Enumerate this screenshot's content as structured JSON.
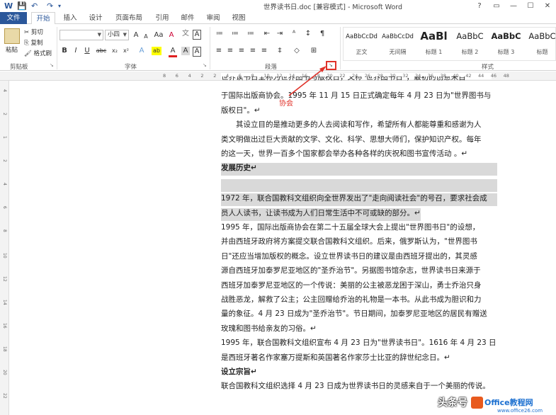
{
  "window": {
    "title": "世界读书日.doc [兼容模式] - Microsoft Word",
    "controls": [
      "?",
      "▭",
      "—",
      "☐",
      "✕"
    ]
  },
  "quick_access": [
    "W",
    "💾",
    "↶",
    "↷",
    "▾"
  ],
  "tabs": [
    "文件",
    "开始",
    "插入",
    "设计",
    "页面布局",
    "引用",
    "邮件",
    "审阅",
    "视图"
  ],
  "ribbon": {
    "clipboard": {
      "paste": "粘贴",
      "cut": "剪切",
      "copy": "复制",
      "format_painter": "格式刷",
      "group_label": "剪贴板"
    },
    "font": {
      "font_name": "",
      "font_size": "小四",
      "group_label": "字体",
      "row1_icons": [
        "A",
        "A",
        "Aa",
        "A"
      ],
      "row2_icons": [
        "B",
        "I",
        "U",
        "abc",
        "x₂",
        "x²",
        "A",
        "ab",
        "A",
        "A",
        "A"
      ]
    },
    "paragraph": {
      "group_label": "段落",
      "row1_icons": [
        "≔",
        "≔",
        "≔",
        "⇤",
        "⇥",
        "ᴬ",
        "↕",
        "¶"
      ],
      "row2_icons": [
        "≡",
        "≡",
        "≡",
        "≡",
        "≡",
        "‡",
        "◇",
        "⊞"
      ]
    },
    "styles": {
      "group_label": "样式",
      "items": [
        {
          "preview": "AaBbCcDd",
          "name": "正文"
        },
        {
          "preview": "AaBbCcDd",
          "name": "无间隔"
        },
        {
          "preview": "AaBl",
          "name": "标题 1"
        },
        {
          "preview": "AaBbC",
          "name": "标题 2"
        },
        {
          "preview": "AaBbC",
          "name": "标题 3"
        },
        {
          "preview": "AaBbC",
          "name": "标题"
        }
      ]
    }
  },
  "ruler": {
    "ticks": [
      "8",
      "6",
      "4",
      "2",
      "2",
      "4",
      "6",
      "8",
      "10",
      "12",
      "14",
      "16",
      "18",
      "20",
      "22",
      "24",
      "26",
      "28",
      "30",
      "32",
      "34",
      "36",
      "38",
      "40",
      "42",
      "44",
      "46",
      "48"
    ],
    "vticks": [
      "4",
      "2",
      "1",
      "2",
      "4",
      "6",
      "8",
      "10",
      "12",
      "14",
      "16",
      "18",
      "20",
      "22"
    ]
  },
  "annotation": {
    "tip": "协会"
  },
  "document": {
    "lines": [
      {
        "text": "世界读书日全称为世界图书与版权日，又称\"世界图书日\"，最初的创意来自",
        "style": "cut"
      },
      {
        "text": "于国际出版商协会。1995 年 11 月 15 日正式确定每年 4 月 23 日为\"世界图书与",
        "style": "normal"
      },
      {
        "text": "版权日\"。↵",
        "style": "normal"
      },
      {
        "text": "　　其设立目的是推动更多的人去阅读和写作，希望所有人都能尊重和感谢为人",
        "style": "normal"
      },
      {
        "text": "类文明做出过巨大贡献的文学、文化、科学、思想大师们，保护知识产权。每年",
        "style": "normal"
      },
      {
        "text": "的这一天，世界一百多个国家都会举办各种各样的庆祝和图书宣传活动 。↵",
        "style": "normal"
      },
      {
        "text": "发展历史↵",
        "style": "heading-hl"
      },
      {
        "text": "",
        "style": "hl"
      },
      {
        "text": "1972 年，联合国教科文组织向全世界发出了\"走向阅读社会\"的号召，要求社会成",
        "style": "hl"
      },
      {
        "text": "员人人读书，让读书成为人们日常生活中不可或缺的部分。↵",
        "style": "hl-short"
      },
      {
        "text": "1995  年，国际出版商协会在第二十五届全球大会上提出\"世界图书日\"的设想，",
        "style": "normal"
      },
      {
        "text": "并由西班牙政府将方案提交联合国教科文组织。后来，俄罗斯认为，\"世界图书",
        "style": "normal"
      },
      {
        "text": "日\"还应当增加版权的概念。设立世界读书日的建议是由西班牙提出的，其灵感",
        "style": "normal"
      },
      {
        "text": "源自西班牙加泰罗尼亚地区的\"圣乔治节\"。另据图书馆杂志，世界读书日来源于",
        "style": "normal"
      },
      {
        "text": "西班牙加泰罗尼亚地区的一个传说：美丽的公主被恶龙困于深山，勇士乔治只身",
        "style": "normal"
      },
      {
        "text": "战胜恶龙，解救了公主；公主回赠给乔治的礼物是一本书。从此书成为胆识和力",
        "style": "normal"
      },
      {
        "text": "量的象征。4 月 23 日成为\"圣乔治节\"。节日期间，加泰罗尼亚地区的居民有赠送",
        "style": "normal"
      },
      {
        "text": "玫瑰和图书给亲友的习俗。↵",
        "style": "normal"
      },
      {
        "text": "1995 年，联合国教科文组织宣布 4 月 23 日为\"世界读书日\"。1616 年 4 月 23 日",
        "style": "normal"
      },
      {
        "text": "是西班牙著名作家塞万提斯和英国著名作家莎士比亚的辞世纪念日。↵",
        "style": "normal"
      },
      {
        "text": "设立宗旨↵",
        "style": "heading"
      },
      {
        "text": "联合国教科文组织选择 4 月 23 日成为世界读书日的灵感来自于一个美丽的传说。",
        "style": "normal"
      }
    ]
  },
  "watermark": {
    "toutiao": "头条号",
    "site": "Office教程网",
    "url": "www.office26.com"
  }
}
